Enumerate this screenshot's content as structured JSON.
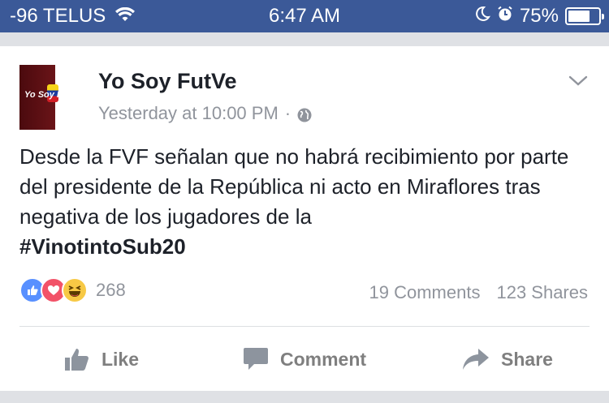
{
  "status_bar": {
    "carrier": "-96 TELUS",
    "time": "6:47 AM",
    "battery_percent": "75%",
    "battery_level": 0.75,
    "icons": [
      "wifi-icon",
      "moon-icon",
      "alarm-icon",
      "battery-icon"
    ]
  },
  "post": {
    "page_name": "Yo Soy FutVe",
    "avatar_text": "Yo Soy FutVe",
    "timestamp": "Yesterday at 10:00 PM",
    "separator": "·",
    "body": "Desde la FVF señalan que no habrá recibimiento por parte del presidente de la República ni acto en Miraflores tras negativa de los jugadores de la",
    "hashtag": "#VinotintoSub20",
    "reaction_count": "268",
    "comments": "19 Comments",
    "shares": "123 Shares"
  },
  "actions": {
    "like": "Like",
    "comment": "Comment",
    "share": "Share"
  },
  "colors": {
    "status_bar_bg": "#3b5998",
    "text_primary": "#1d2129",
    "text_secondary": "#90949c",
    "like": "#5890ff",
    "love": "#f25268",
    "haha": "#f7c945"
  }
}
